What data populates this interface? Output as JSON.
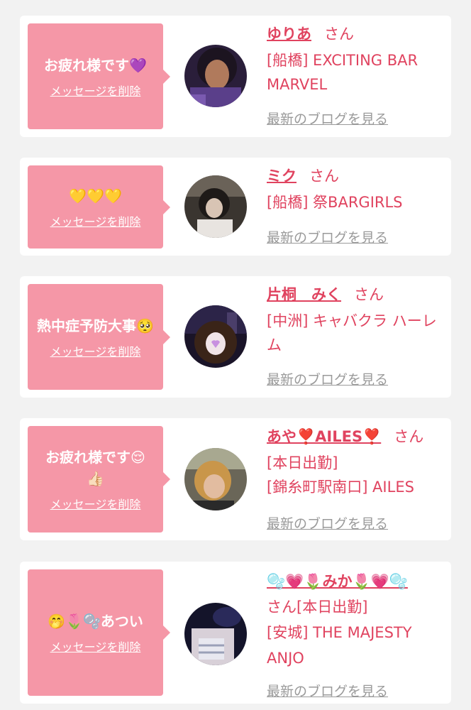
{
  "cards": [
    {
      "message": "お疲れ様です💜",
      "delete_label": "メッセージを削除",
      "name": "ゆりあ",
      "honorific": "さん",
      "shop": "[船橋] EXCITING BAR MARVEL",
      "blog_label": "最新のブログを見る"
    },
    {
      "message": "💛💛💛",
      "delete_label": "メッセージを削除",
      "name": "ミク",
      "honorific": "さん",
      "shop": "[船橋] 祭BARGIRLS",
      "blog_label": "最新のブログを見る"
    },
    {
      "message": "熱中症予防大事🥺",
      "delete_label": "メッセージを削除",
      "name": "片桐　みく",
      "honorific": "さん",
      "shop": "[中洲] キャバクラ ハーレム",
      "blog_label": "最新のブログを見る"
    },
    {
      "message": "お疲れ様です😌👍🏻",
      "delete_label": "メッセージを削除",
      "name": "あや❣️AILES❣️",
      "honorific": "さん",
      "shop": "[本日出勤]\n[錦糸町駅南口] AILES",
      "blog_label": "最新のブログを見る"
    },
    {
      "message": "🤭🌷🫧あつい",
      "delete_label": "メッセージを削除",
      "name": "🫧💗🌷みか🌷💗🫧",
      "honorific": "さん",
      "shop": "[本日出勤]\n[安城] THE MAJESTY ANJO",
      "blog_label": "最新のブログを見る"
    }
  ]
}
